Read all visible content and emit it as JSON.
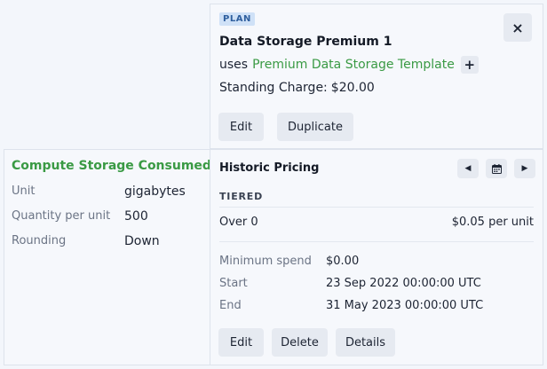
{
  "plan": {
    "badge": "PLAN",
    "title": "Data Storage Premium 1",
    "uses_prefix": "uses",
    "template_link": "Premium Data Storage Template",
    "standing_charge_label": "Standing Charge:",
    "standing_charge_value": "$20.00",
    "buttons": {
      "edit": "Edit",
      "duplicate": "Duplicate"
    },
    "icons": {
      "close": "×",
      "add": "+"
    }
  },
  "metric": {
    "title": "Compute Storage Consumed",
    "fields": [
      {
        "label": "Unit",
        "value": "gigabytes"
      },
      {
        "label": "Quantity per unit",
        "value": "500"
      },
      {
        "label": "Rounding",
        "value": "Down"
      }
    ]
  },
  "pricing": {
    "title": "Historic Pricing",
    "model": "TIERED",
    "tier": {
      "range": "Over 0",
      "price": "$0.05 per unit"
    },
    "details": [
      {
        "label": "Minimum spend",
        "value": "$0.00"
      },
      {
        "label": "Start",
        "value": "23 Sep 2022 00:00:00 UTC"
      },
      {
        "label": "End",
        "value": "31 May 2023 00:00:00 UTC"
      }
    ],
    "buttons": {
      "edit": "Edit",
      "delete": "Delete",
      "details": "Details"
    }
  },
  "colors": {
    "accent_green": "#3a9a44",
    "badge_bg": "#cfe1f7",
    "badge_text": "#2f5f9e"
  }
}
